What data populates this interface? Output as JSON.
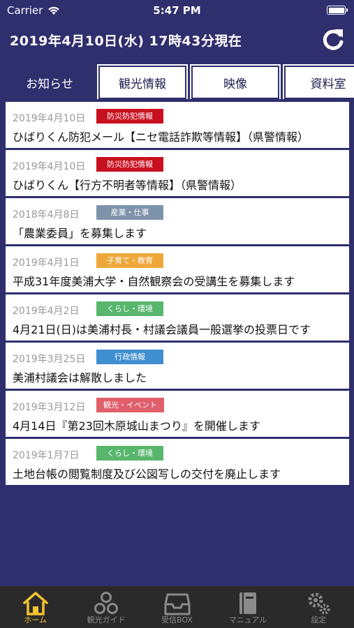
{
  "status_bar": {
    "carrier": "Carrier",
    "time": "5:47 PM"
  },
  "header": {
    "title": "2019年4月10日(水) 17時43分現在"
  },
  "tabs": [
    {
      "label": "お知らせ"
    },
    {
      "label": "観光情報"
    },
    {
      "label": "映像"
    },
    {
      "label": "資料室"
    }
  ],
  "news": [
    {
      "date": "2019年4月10日",
      "category": "防災防犯情報",
      "category_color": "#c8101e",
      "title": "ひばりくん防犯メール【ニセ電話詐欺等情報】（県警情報）"
    },
    {
      "date": "2019年4月10日",
      "category": "防災防犯情報",
      "category_color": "#c8101e",
      "title": "ひばりくん【行方不明者等情報】（県警情報）"
    },
    {
      "date": "2018年4月8日",
      "category": "産業・仕事",
      "category_color": "#7e93ab",
      "title": "「農業委員」を募集します"
    },
    {
      "date": "2019年4月1日",
      "category": "子育て・教育",
      "category_color": "#eea83a",
      "title": "平成31年度美浦大学・自然観察会の受講生を募集します"
    },
    {
      "date": "2019年4月2日",
      "category": "くらし・環境",
      "category_color": "#58b66d",
      "title": "4月21日(日)は美浦村長・村議会議員一般選挙の投票日です"
    },
    {
      "date": "2019年3月25日",
      "category": "行政情報",
      "category_color": "#3f8ed0",
      "title": "美浦村議会は解散しました"
    },
    {
      "date": "2019年3月12日",
      "category": "観光・イベント",
      "category_color": "#e05f6b",
      "title": "4月14日『第23回木原城山まつり』を開催します"
    },
    {
      "date": "2019年1月7日",
      "category": "くらし・環境",
      "category_color": "#58b66d",
      "title": "土地台帳の閲覧制度及び公図写しの交付を廃止します"
    }
  ],
  "tabbar": [
    {
      "label": "ホーム",
      "icon": "home-icon"
    },
    {
      "label": "観光ガイド",
      "icon": "tourism-icon"
    },
    {
      "label": "受信BOX",
      "icon": "inbox-icon"
    },
    {
      "label": "マニュアル",
      "icon": "manual-icon"
    },
    {
      "label": "設定",
      "icon": "settings-icon"
    }
  ],
  "colors": {
    "navy": "#2f2f6e",
    "tabbar_active": "#f2c230",
    "tabbar_bg": "#2a2a2a"
  }
}
